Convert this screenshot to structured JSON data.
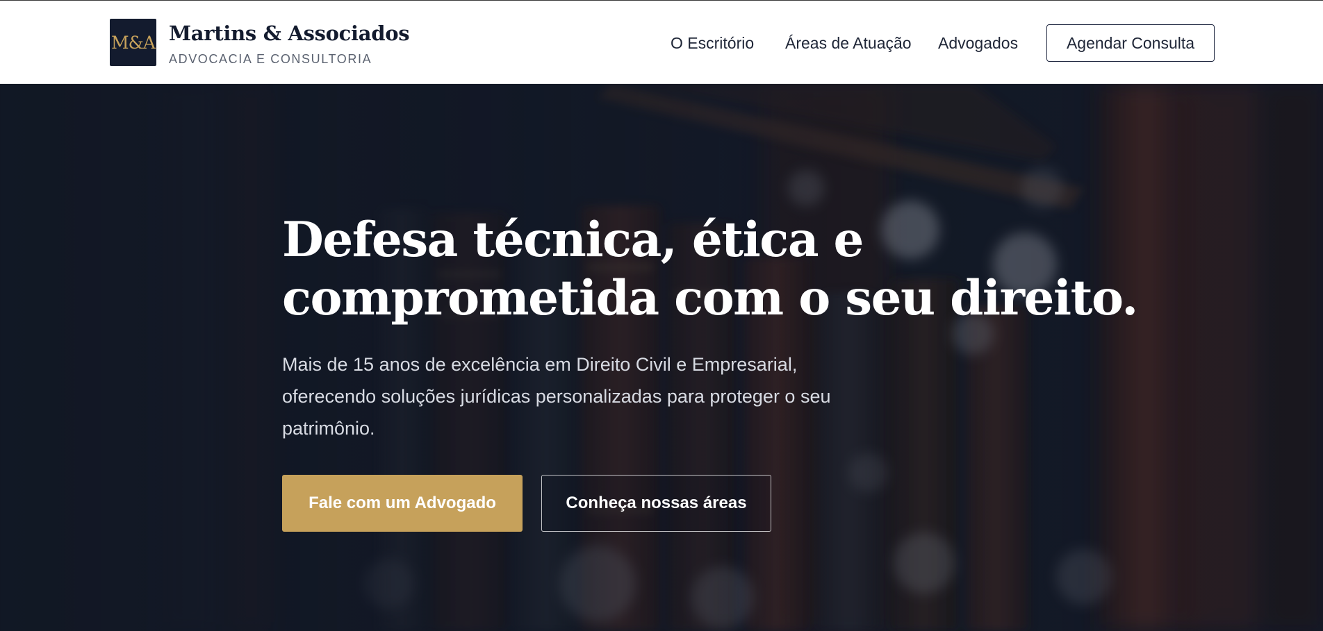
{
  "header": {
    "logo_monogram": "M&A",
    "brand_name": "Martins & Associados",
    "brand_subtitle": "ADVOCACIA E CONSULTORIA",
    "nav": [
      "O Escritório",
      "Áreas de Atuação",
      "Advogados"
    ],
    "cta_label": "Agendar Consulta"
  },
  "hero": {
    "title_line_1": "Defesa técnica, ética e",
    "title_line_2": "comprometida com o seu direito.",
    "description": "Mais de 15 anos de excelência em Direito Civil e Empresarial, oferecendo soluções jurídicas personalizadas para proteger o seu patrimônio.",
    "primary_button": "Fale com um Advogado",
    "secondary_button": "Conheça nossas áreas",
    "background_image": "blurred law library bookshelf"
  },
  "colors": {
    "navy": "#131b2e",
    "gold": "#c6a15b",
    "white": "#ffffff"
  }
}
